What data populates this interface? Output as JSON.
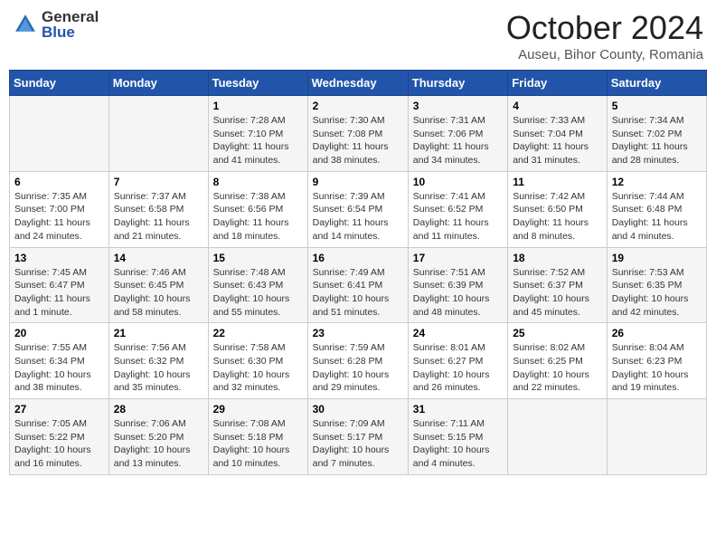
{
  "header": {
    "logo_general": "General",
    "logo_blue": "Blue",
    "month_title": "October 2024",
    "location": "Auseu, Bihor County, Romania"
  },
  "days_of_week": [
    "Sunday",
    "Monday",
    "Tuesday",
    "Wednesday",
    "Thursday",
    "Friday",
    "Saturday"
  ],
  "weeks": [
    [
      {
        "day": "",
        "info": ""
      },
      {
        "day": "",
        "info": ""
      },
      {
        "day": "1",
        "info": "Sunrise: 7:28 AM\nSunset: 7:10 PM\nDaylight: 11 hours and 41 minutes."
      },
      {
        "day": "2",
        "info": "Sunrise: 7:30 AM\nSunset: 7:08 PM\nDaylight: 11 hours and 38 minutes."
      },
      {
        "day": "3",
        "info": "Sunrise: 7:31 AM\nSunset: 7:06 PM\nDaylight: 11 hours and 34 minutes."
      },
      {
        "day": "4",
        "info": "Sunrise: 7:33 AM\nSunset: 7:04 PM\nDaylight: 11 hours and 31 minutes."
      },
      {
        "day": "5",
        "info": "Sunrise: 7:34 AM\nSunset: 7:02 PM\nDaylight: 11 hours and 28 minutes."
      }
    ],
    [
      {
        "day": "6",
        "info": "Sunrise: 7:35 AM\nSunset: 7:00 PM\nDaylight: 11 hours and 24 minutes."
      },
      {
        "day": "7",
        "info": "Sunrise: 7:37 AM\nSunset: 6:58 PM\nDaylight: 11 hours and 21 minutes."
      },
      {
        "day": "8",
        "info": "Sunrise: 7:38 AM\nSunset: 6:56 PM\nDaylight: 11 hours and 18 minutes."
      },
      {
        "day": "9",
        "info": "Sunrise: 7:39 AM\nSunset: 6:54 PM\nDaylight: 11 hours and 14 minutes."
      },
      {
        "day": "10",
        "info": "Sunrise: 7:41 AM\nSunset: 6:52 PM\nDaylight: 11 hours and 11 minutes."
      },
      {
        "day": "11",
        "info": "Sunrise: 7:42 AM\nSunset: 6:50 PM\nDaylight: 11 hours and 8 minutes."
      },
      {
        "day": "12",
        "info": "Sunrise: 7:44 AM\nSunset: 6:48 PM\nDaylight: 11 hours and 4 minutes."
      }
    ],
    [
      {
        "day": "13",
        "info": "Sunrise: 7:45 AM\nSunset: 6:47 PM\nDaylight: 11 hours and 1 minute."
      },
      {
        "day": "14",
        "info": "Sunrise: 7:46 AM\nSunset: 6:45 PM\nDaylight: 10 hours and 58 minutes."
      },
      {
        "day": "15",
        "info": "Sunrise: 7:48 AM\nSunset: 6:43 PM\nDaylight: 10 hours and 55 minutes."
      },
      {
        "day": "16",
        "info": "Sunrise: 7:49 AM\nSunset: 6:41 PM\nDaylight: 10 hours and 51 minutes."
      },
      {
        "day": "17",
        "info": "Sunrise: 7:51 AM\nSunset: 6:39 PM\nDaylight: 10 hours and 48 minutes."
      },
      {
        "day": "18",
        "info": "Sunrise: 7:52 AM\nSunset: 6:37 PM\nDaylight: 10 hours and 45 minutes."
      },
      {
        "day": "19",
        "info": "Sunrise: 7:53 AM\nSunset: 6:35 PM\nDaylight: 10 hours and 42 minutes."
      }
    ],
    [
      {
        "day": "20",
        "info": "Sunrise: 7:55 AM\nSunset: 6:34 PM\nDaylight: 10 hours and 38 minutes."
      },
      {
        "day": "21",
        "info": "Sunrise: 7:56 AM\nSunset: 6:32 PM\nDaylight: 10 hours and 35 minutes."
      },
      {
        "day": "22",
        "info": "Sunrise: 7:58 AM\nSunset: 6:30 PM\nDaylight: 10 hours and 32 minutes."
      },
      {
        "day": "23",
        "info": "Sunrise: 7:59 AM\nSunset: 6:28 PM\nDaylight: 10 hours and 29 minutes."
      },
      {
        "day": "24",
        "info": "Sunrise: 8:01 AM\nSunset: 6:27 PM\nDaylight: 10 hours and 26 minutes."
      },
      {
        "day": "25",
        "info": "Sunrise: 8:02 AM\nSunset: 6:25 PM\nDaylight: 10 hours and 22 minutes."
      },
      {
        "day": "26",
        "info": "Sunrise: 8:04 AM\nSunset: 6:23 PM\nDaylight: 10 hours and 19 minutes."
      }
    ],
    [
      {
        "day": "27",
        "info": "Sunrise: 7:05 AM\nSunset: 5:22 PM\nDaylight: 10 hours and 16 minutes."
      },
      {
        "day": "28",
        "info": "Sunrise: 7:06 AM\nSunset: 5:20 PM\nDaylight: 10 hours and 13 minutes."
      },
      {
        "day": "29",
        "info": "Sunrise: 7:08 AM\nSunset: 5:18 PM\nDaylight: 10 hours and 10 minutes."
      },
      {
        "day": "30",
        "info": "Sunrise: 7:09 AM\nSunset: 5:17 PM\nDaylight: 10 hours and 7 minutes."
      },
      {
        "day": "31",
        "info": "Sunrise: 7:11 AM\nSunset: 5:15 PM\nDaylight: 10 hours and 4 minutes."
      },
      {
        "day": "",
        "info": ""
      },
      {
        "day": "",
        "info": ""
      }
    ]
  ]
}
